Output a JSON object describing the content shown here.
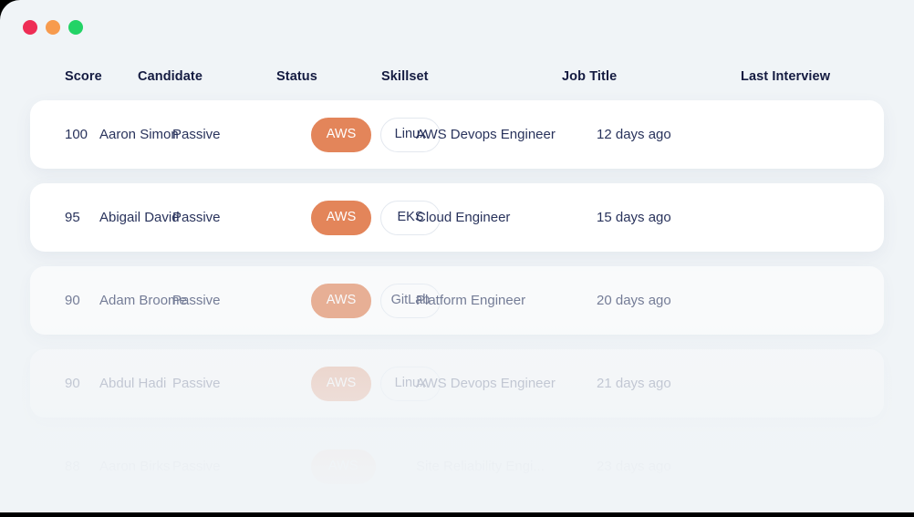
{
  "window": {
    "controls": [
      {
        "name": "close",
        "color": "#EE2D55"
      },
      {
        "name": "minimize",
        "color": "#F79B4E"
      },
      {
        "name": "maximize",
        "color": "#23D366"
      }
    ]
  },
  "table": {
    "columns": [
      "Score",
      "Candidate",
      "Status",
      "Skillset",
      "Job Title",
      "Last Interview"
    ],
    "rows": [
      {
        "score": "100",
        "candidate": "Aaron Simon",
        "status": "Passive",
        "skills": [
          {
            "label": "AWS",
            "style": "primary"
          },
          {
            "label": "Linux",
            "style": "outline"
          }
        ],
        "job_title": "AWS Devops Engineer",
        "last_interview": "12 days ago"
      },
      {
        "score": "95",
        "candidate": "Abigail David",
        "status": "Passive",
        "skills": [
          {
            "label": "AWS",
            "style": "primary"
          },
          {
            "label": "EKS",
            "style": "outline"
          }
        ],
        "job_title": "Cloud Engineer",
        "last_interview": "15 days ago"
      },
      {
        "score": "90",
        "candidate": "Adam Broome",
        "status": "Passive",
        "skills": [
          {
            "label": "AWS",
            "style": "primary"
          },
          {
            "label": "GitLab",
            "style": "outline"
          }
        ],
        "job_title": "Platform Engineer",
        "last_interview": "20 days ago"
      },
      {
        "score": "90",
        "candidate": "Abdul Hadi",
        "status": "Passive",
        "skills": [
          {
            "label": "AWS",
            "style": "primary"
          },
          {
            "label": "Linux",
            "style": "outline"
          }
        ],
        "job_title": "AWS Devops Engineer",
        "last_interview": "21 days ago"
      },
      {
        "score": "88",
        "candidate": "Aaron Birks",
        "status": "Passive",
        "skills": [
          {
            "label": "AWS",
            "style": "primary"
          }
        ],
        "job_title": "Site Reliability Engi...",
        "last_interview": "23 days ago"
      }
    ]
  },
  "colors": {
    "page_background": "#F0F4F7",
    "card_background": "#FFFFFF",
    "text_primary": "#29335C",
    "header_text": "#141B41",
    "chip_primary": "#E3855A",
    "chip_outline_border": "#E3E8EF"
  }
}
